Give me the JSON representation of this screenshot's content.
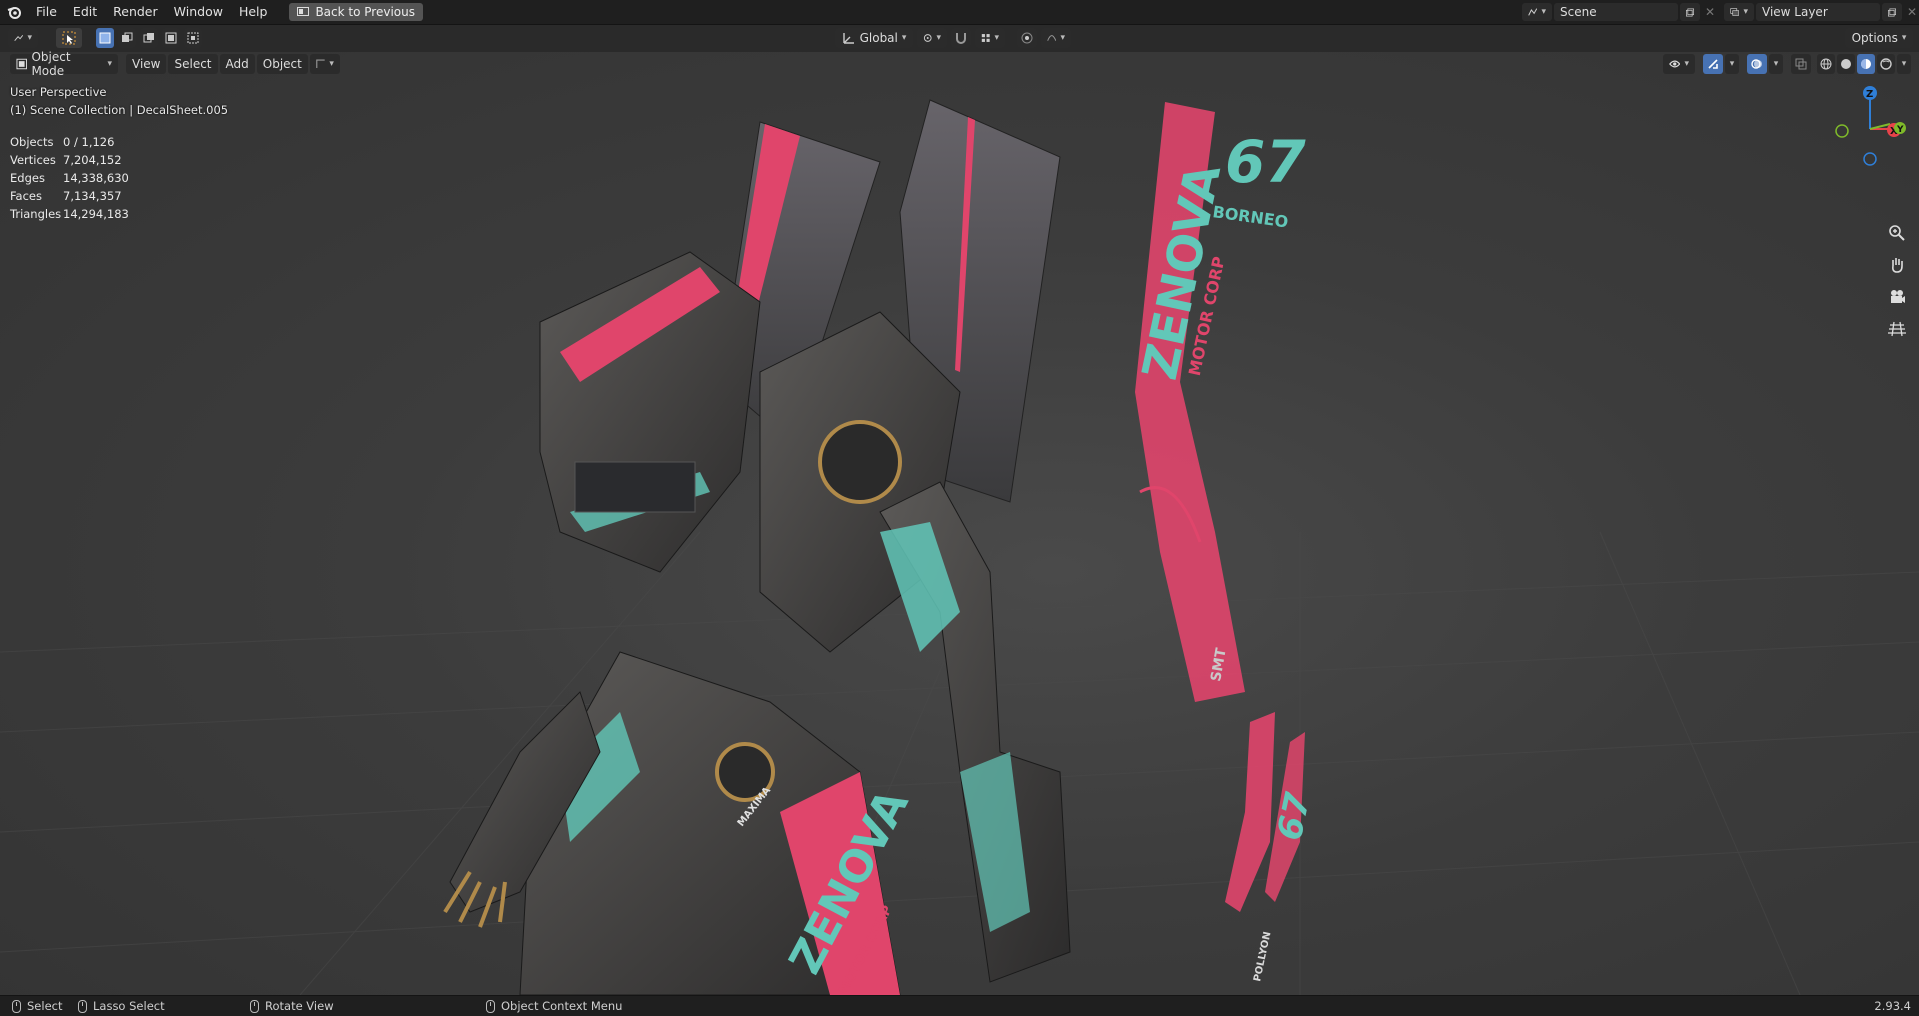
{
  "topbar": {
    "menu": [
      "File",
      "Edit",
      "Render",
      "Window",
      "Help"
    ],
    "back_button": "Back to Previous",
    "scene": "Scene",
    "view_layer": "View Layer"
  },
  "header": {
    "transform_orientation": "Global",
    "options_label": "Options"
  },
  "viewheader": {
    "mode": "Object Mode",
    "menus": [
      "View",
      "Select",
      "Add",
      "Object"
    ]
  },
  "viewport": {
    "perspective": "User Perspective",
    "collection": "(1) Scene Collection | DecalSheet.005",
    "stats": [
      {
        "label": "Objects",
        "value": "0 / 1,126"
      },
      {
        "label": "Vertices",
        "value": "7,204,152"
      },
      {
        "label": "Edges",
        "value": "14,338,630"
      },
      {
        "label": "Faces",
        "value": "7,134,357"
      },
      {
        "label": "Triangles",
        "value": "14,294,183"
      }
    ],
    "gizmo": {
      "z": "Z",
      "x": "X",
      "y": "Y"
    },
    "decal_text": {
      "brand": "ZENOVA",
      "sub": "MOTOR CORP",
      "number": "67",
      "name": "BORNEO",
      "smt": "SMT",
      "pollyon": "POLLYON",
      "maxima": "MAXIMA"
    }
  },
  "statusbar": {
    "select": "Select",
    "lasso": "Lasso Select",
    "rotate": "Rotate View",
    "context": "Object Context Menu",
    "version": "2.93.4"
  },
  "colors": {
    "accent": "#4772b3",
    "pink": "#e0456b",
    "teal": "#62c7b8",
    "axis_x": "#e8434a",
    "axis_y": "#7fba2a",
    "axis_z": "#2f7fd8"
  }
}
